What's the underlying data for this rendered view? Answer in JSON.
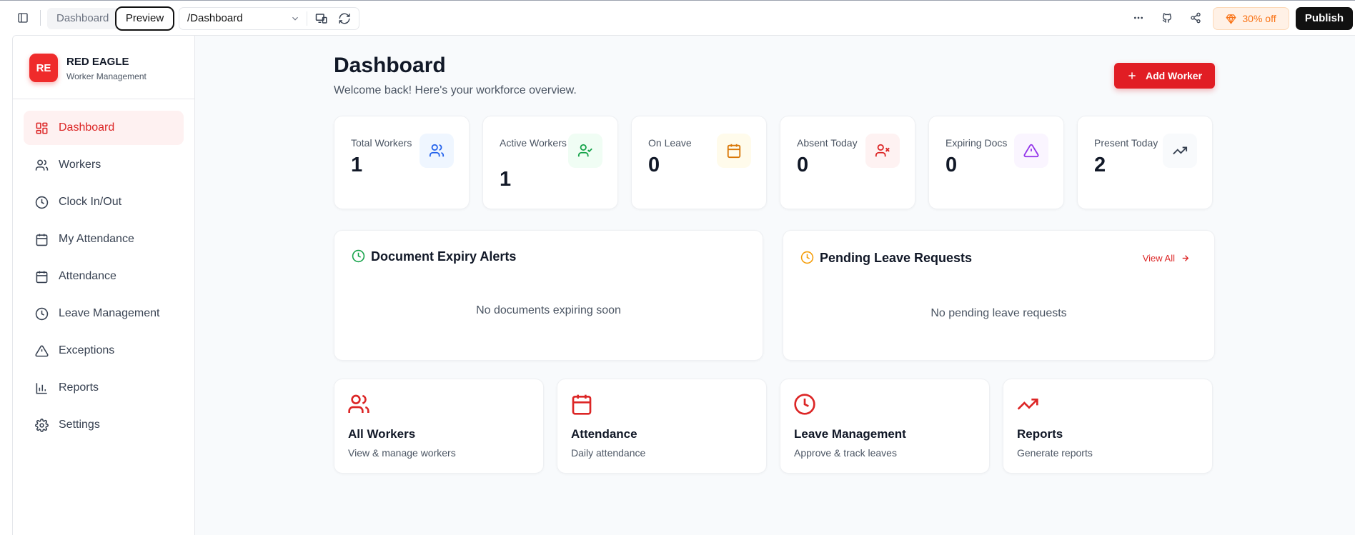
{
  "topbar": {
    "tab_dashboard": "Dashboard",
    "tab_preview": "Preview",
    "url": "/Dashboard",
    "promo": "30% off",
    "publish": "Publish"
  },
  "brand": {
    "logo": "RE",
    "name": "RED EAGLE",
    "subtitle": "Worker Management"
  },
  "sidebar": {
    "items": [
      {
        "label": "Dashboard",
        "icon": "grid-icon",
        "active": true
      },
      {
        "label": "Workers",
        "icon": "users-icon"
      },
      {
        "label": "Clock In/Out",
        "icon": "clock-icon"
      },
      {
        "label": "My Attendance",
        "icon": "calendar-icon"
      },
      {
        "label": "Attendance",
        "icon": "calendar-icon"
      },
      {
        "label": "Leave Management",
        "icon": "clock-icon"
      },
      {
        "label": "Exceptions",
        "icon": "alert-icon"
      },
      {
        "label": "Reports",
        "icon": "bar-chart-icon"
      },
      {
        "label": "Settings",
        "icon": "gear-icon"
      }
    ]
  },
  "header": {
    "title": "Dashboard",
    "subtitle": "Welcome back! Here's your workforce overview.",
    "add_button": "Add Worker"
  },
  "stats": [
    {
      "label": "Total Workers",
      "value": "1",
      "icon": "users-icon",
      "color": "#2563eb",
      "bg": "#eff6ff"
    },
    {
      "label": "Active Workers",
      "value": "1",
      "icon": "user-check-icon",
      "color": "#16a34a",
      "bg": "#f0fdf4"
    },
    {
      "label": "On Leave",
      "value": "0",
      "icon": "calendar-icon",
      "color": "#d97706",
      "bg": "#fffbeb"
    },
    {
      "label": "Absent Today",
      "value": "0",
      "icon": "user-x-icon",
      "color": "#dc2626",
      "bg": "#fef2f2"
    },
    {
      "label": "Expiring Docs",
      "value": "0",
      "icon": "alert-icon",
      "color": "#9333ea",
      "bg": "#faf5ff"
    },
    {
      "label": "Present Today",
      "value": "2",
      "icon": "trending-up-icon",
      "color": "#374151",
      "bg": "#f8fafc"
    }
  ],
  "panels": {
    "expiry": {
      "title": "Document Expiry Alerts",
      "empty": "No documents expiring soon",
      "color": "#16a34a"
    },
    "leave": {
      "title": "Pending Leave Requests",
      "empty": "No pending leave requests",
      "view_all": "View All",
      "color": "#f59e0b"
    }
  },
  "quick_links": [
    {
      "title": "All Workers",
      "subtitle": "View & manage workers",
      "icon": "users-icon"
    },
    {
      "title": "Attendance",
      "subtitle": "Daily attendance",
      "icon": "calendar-icon"
    },
    {
      "title": "Leave Management",
      "subtitle": "Approve & track leaves",
      "icon": "clock-icon"
    },
    {
      "title": "Reports",
      "subtitle": "Generate reports",
      "icon": "trending-up-icon"
    }
  ],
  "colors": {
    "accent": "#e11d24",
    "accent_soft": "#fef1f1"
  }
}
